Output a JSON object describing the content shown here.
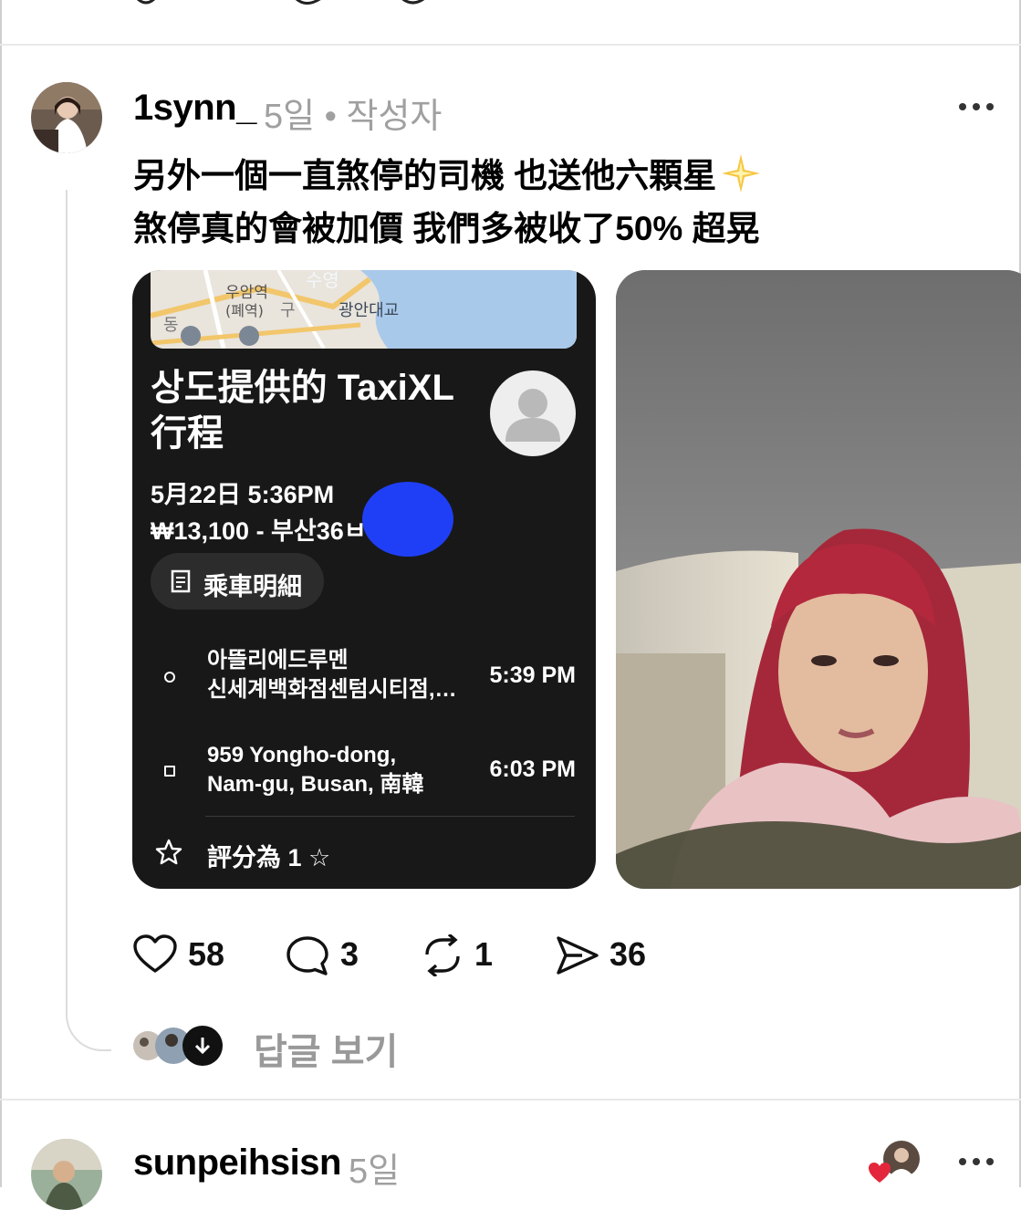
{
  "post": {
    "username": "1synn_",
    "meta": "5일 • 작성자",
    "text_line1": "另外一個一直煞停的司機 也送他六顆星",
    "text_line2": "煞停真的會被加價 我們多被收了50% 超晃",
    "emoji": "sparkle",
    "ride_card": {
      "map_labels": [
        "우암역",
        "(폐역)",
        "수영",
        "광안대교",
        "동",
        "구"
      ],
      "title": "상도提供的 TaxiXL\n行程",
      "date": "5月22日 5:36PM",
      "fare": "₩13,100 - 부산36ㅂ",
      "details_button": "乘車明細",
      "stops": [
        {
          "address": "아뜰리에드루멘\n신세계백화점센텀시티점,…",
          "time": "5:39 PM"
        },
        {
          "address": "959 Yongho-dong,\nNam-gu, Busan, 南韓",
          "time": "6:03 PM"
        }
      ],
      "rating": "評分為 1 ☆"
    },
    "actions": {
      "likes": "58",
      "comments": "3",
      "reposts": "1",
      "shares": "36"
    },
    "view_replies": "답글 보기"
  },
  "next_post": {
    "username": "sunpeihsisn",
    "meta": "5일"
  },
  "colors": {
    "background": "#ffffff",
    "card": "#181818",
    "muted_text": "#a0a0a0",
    "redact_blue": "#1f3ff7"
  },
  "icons": [
    "heart-icon",
    "comment-icon",
    "repost-icon",
    "share-icon",
    "more-icon",
    "star-icon",
    "receipt-icon",
    "down-arrow-icon",
    "person-icon"
  ]
}
